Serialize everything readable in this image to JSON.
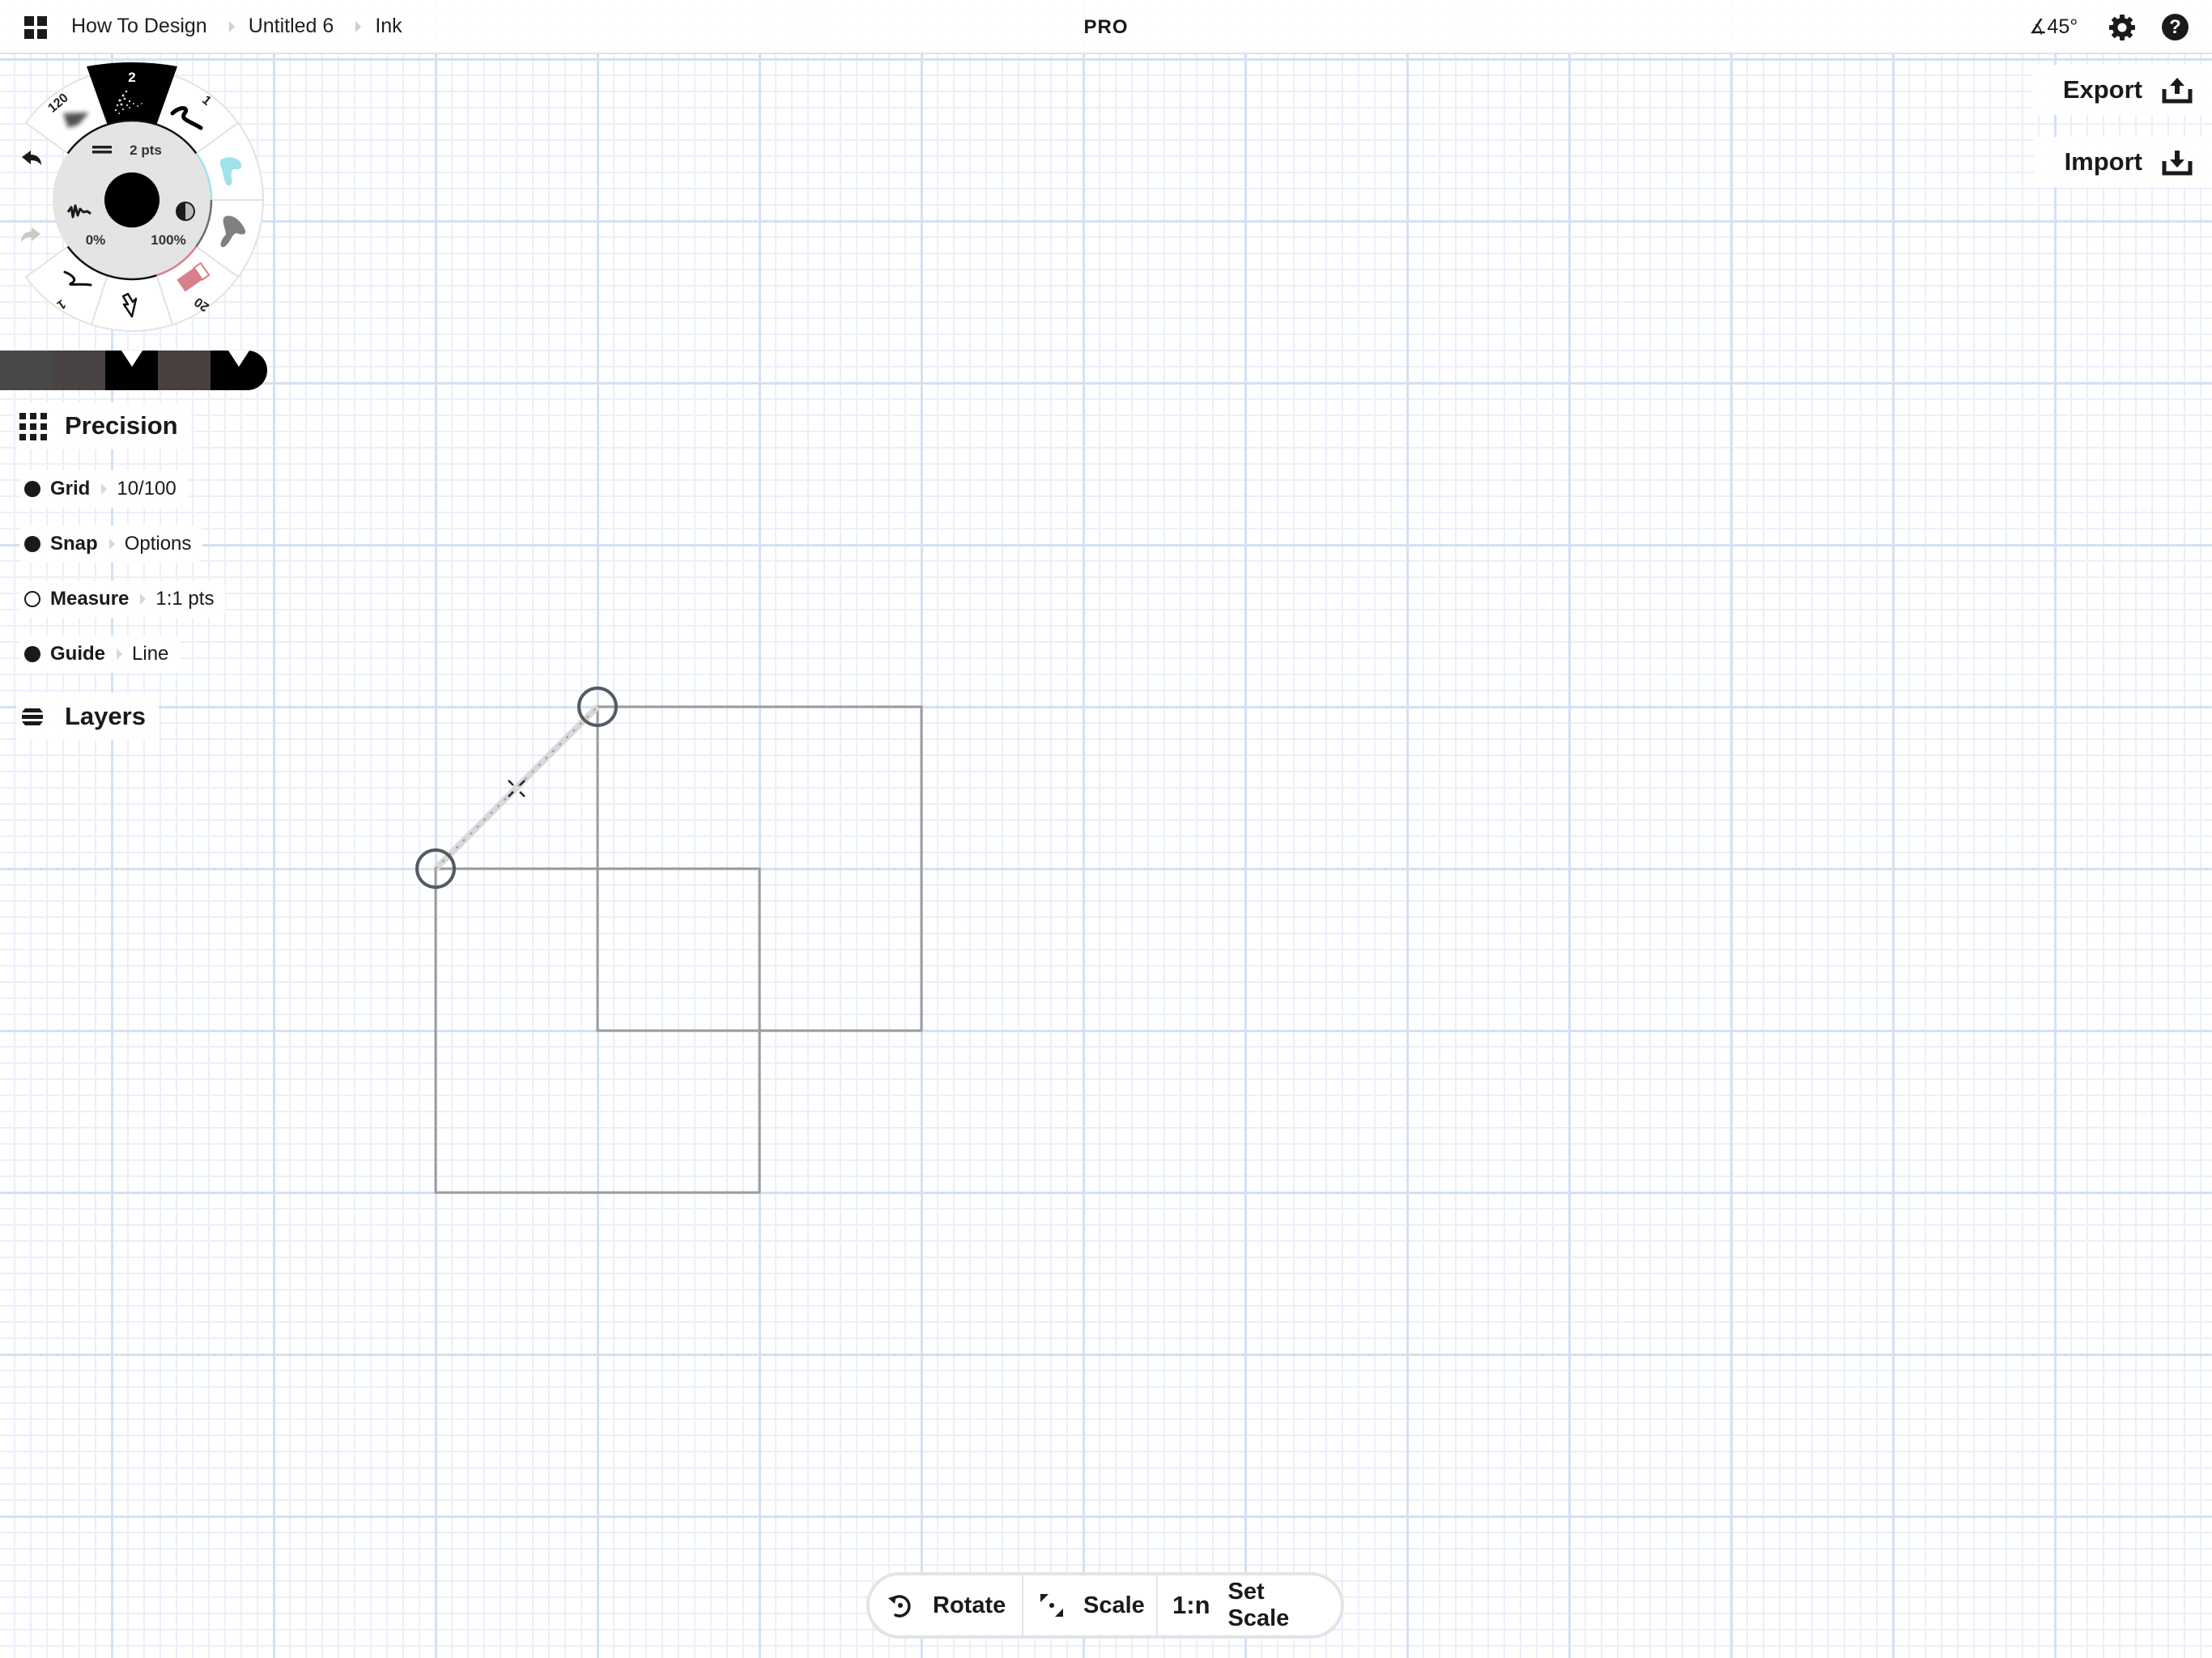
{
  "topbar": {
    "apps_icon": "grid-apps-icon",
    "breadcrumbs": [
      "How To Design",
      "Untitled 6",
      "Ink"
    ],
    "badge": "PRO",
    "angle": "∡45°",
    "settings_icon": "gear-icon",
    "help_label": "?"
  },
  "actions": {
    "export_label": "Export",
    "import_label": "Import"
  },
  "tool_wheel": {
    "selected_tool_size": "2",
    "brush_size": "120",
    "pen_size": "1",
    "pencil_size": "1",
    "eraser_size": "20",
    "thickness_label": "2 pts",
    "smoothing_label": "0%",
    "opacity_label": "100%",
    "current_color": "#000000"
  },
  "color_swatches": [
    "#484848",
    "#4a4343",
    "#000000",
    "#4a3f3f",
    "#000000"
  ],
  "precision": {
    "title": "Precision",
    "rows": [
      {
        "name": "Grid",
        "value": "10/100",
        "enabled": true
      },
      {
        "name": "Snap",
        "value": "Options",
        "enabled": true
      },
      {
        "name": "Measure",
        "value": "1:1 pts",
        "enabled": false
      },
      {
        "name": "Guide",
        "value": "Line",
        "enabled": true
      }
    ]
  },
  "layers": {
    "title": "Layers"
  },
  "guide_toolbar": {
    "rotate_label": "Rotate",
    "scale_label": "Scale",
    "ratio_icon_text": "1:n",
    "set_scale_label": "Set Scale"
  }
}
